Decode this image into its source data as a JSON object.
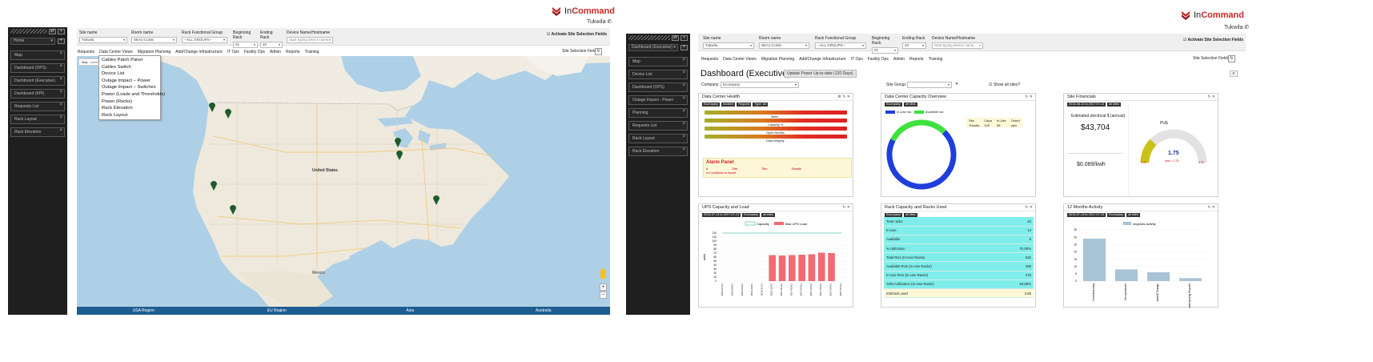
{
  "brand": {
    "name_in": "In",
    "name_command": "Command"
  },
  "screen1": {
    "site_location": "Tukwila",
    "sidebar": {
      "select": "Home",
      "items": [
        "Map",
        "Dashboard (OPS)",
        "Dashboard (Executive)",
        "Dashboard (KPI)",
        "Requests List",
        "Rack Layout",
        "Rack Elevation"
      ]
    },
    "filters": {
      "site_label": "Site name",
      "site_value": "Tukwila",
      "room_label": "Room name",
      "room_value": "SEA1-Colo5",
      "rfg_label": "Rack Functional Group",
      "rfg_value": "--ALL GROUPS--",
      "begin_label": "Beginning Rack",
      "begin_value": "01",
      "end_label": "Ending Rack",
      "end_value": "20",
      "device_label": "Device Name/Hostname",
      "device_placeholder": "Start typing device name...",
      "activate_label": "Activate Site Selection Fields"
    },
    "tabs": [
      "Requests",
      "Data Center Views",
      "Migration Planning",
      "Add/Change Infrastructure",
      "IT Ops",
      "Facility Ops",
      "Admin",
      "Reports",
      "Training"
    ],
    "site_selection_fields": "Site Selection Fields",
    "dropdown": [
      "Cables Patch Panel",
      "Cables Switch",
      "Device List",
      "Outage Impact – Power",
      "Outage Impact – Switches",
      "Power (Loads and Thresholds)",
      "Power (Racks)",
      "Rack Elevation",
      "Rack Layout"
    ],
    "map": {
      "toggle_map": "Map",
      "toggle_sat": "Satellite",
      "labels": {
        "country": "United States",
        "mexico": "Mexico"
      },
      "regions": [
        "USA Region",
        "EU Region",
        "Asia",
        "Australia"
      ]
    }
  },
  "screen2": {
    "site_location": "Tukwila",
    "sidebar": {
      "select": "Dashboard (Executive)",
      "items": [
        "Map",
        "Device List",
        "Dashboard (OPS)",
        "Outage Impact - Power",
        "Planning",
        "Requests List",
        "Rack Layout",
        "Rack Elevation"
      ]
    },
    "filters": {
      "site_label": "Site name",
      "site_value": "Tukwila",
      "room_label": "Room name",
      "room_value": "SEA1-Colo5",
      "rfg_label": "Rack Functional Group",
      "rfg_value": "--ALL GROUPS--",
      "begin_label": "Beginning Rack",
      "begin_value": "01",
      "end_label": "Ending Rack",
      "end_value": "20",
      "device_label": "Device Name/Hostname",
      "device_placeholder": "Start typing device name...",
      "activate_label": "Activate Site Selection Fields"
    },
    "tabs": [
      "Requests",
      "Data Center Views",
      "Migration Planning",
      "Add/Change Infrastructure",
      "IT Ops",
      "Facility Ops",
      "Admin",
      "Reports",
      "Training"
    ],
    "site_selection_fields": "Site Selection Fields",
    "dashboard": {
      "title": "Dashboard (Executive)",
      "update_button": "Update Power Up-to-date (120 Days)",
      "company_label": "Company:",
      "company_value": "Ecompany",
      "site_group_label": "Site Group:",
      "show_all_label": "Show all sites?"
    },
    "dc_health": {
      "title": "Data Center Health",
      "chips": [
        "Ecompany",
        "Incident",
        "Request",
        "Type: all"
      ],
      "bar_labels": [
        "Maint",
        "Capacity %",
        "Open Months",
        "Data Integrity"
      ],
      "alarm_title": "Alarm Panel",
      "alarm_cols": [
        "#",
        "Site",
        "Title",
        "Details"
      ],
      "alarm_none": "no incidents to report"
    },
    "capacity": {
      "title": "Data Center Capacity Overview",
      "chips": [
        "Ecompany",
        "all sites"
      ],
      "legend_inuse": "In-Use rac",
      "legend_avail": "Available rac",
      "headers": [
        "Site",
        "Capa",
        "In-Use",
        "Outed"
      ],
      "row": [
        "Tukwila",
        "100",
        "58",
        "uplo"
      ],
      "inuse_color": "#1e3fdc",
      "avail_color": "#3fe13f"
    },
    "financials": {
      "title": "Site Financials",
      "chips": [
        "2016-08-13 to 2017-07-13",
        "all sites"
      ],
      "subtitle": "Estimated electrical $ (annual)",
      "amount": "$43,704",
      "rate": "$0.089/kwh",
      "pue_label": "PUE",
      "pue_value": "1.75",
      "pue_min": "1.00",
      "pue_max": "4.00",
      "pue_note": "max = 1.75"
    },
    "ups": {
      "title": "UPS Capacity and Load",
      "chips": [
        "2016-07-13 to 2017-07-13",
        "Ecompany",
        "all sites"
      ],
      "legend_capacity": "Capacity",
      "legend_max": "Max UPS Load",
      "ylabel": "units"
    },
    "rack_capacity": {
      "title": "Rack Capacity and Racks Used",
      "chips": [
        "Ecompany",
        "all sites"
      ],
      "rows": [
        {
          "label": "Total racks",
          "value": "20",
          "style": "teal"
        },
        {
          "label": "In-Use",
          "value": "14",
          "style": "teal"
        },
        {
          "label": "Available",
          "value": "6",
          "style": "teal"
        },
        {
          "label": "% Utilization",
          "value": "70.00%",
          "style": "teal"
        },
        {
          "label": "Total RUs (In-Use Racks)",
          "value": "631",
          "style": "teal"
        },
        {
          "label": "Available RUs (In-Use Racks)",
          "value": "255",
          "style": "teal"
        },
        {
          "label": "In-Use RUs (In-Use Racks)",
          "value": "376",
          "style": "teal"
        },
        {
          "label": "%RU Utilization (In-Use Racks)",
          "value": "59.59%",
          "style": "teal"
        },
        {
          "label": "KW/rack used",
          "value": "3.95",
          "style": "yel"
        }
      ]
    },
    "activity": {
      "title": "12 Months Activity",
      "chips": [
        "2016-07-13 to 2017-07-13",
        "Ecompany",
        "all sites"
      ],
      "legend": "requests activity"
    }
  },
  "chart_data": [
    {
      "type": "bar",
      "title": "UPS Capacity and Load",
      "xlabel": "",
      "ylabel": "units",
      "categories": [
        "2016-07-01",
        "2016-08-01",
        "2016-09-01",
        "2016-10-01",
        "2016-11-01",
        "2016-12-01",
        "2017-01-01",
        "2017-02-01",
        "2017-03-01",
        "2017-04-01",
        "2017-05-01",
        "2017-06-01",
        "2017-07-01"
      ],
      "series": [
        {
          "name": "Capacity",
          "type": "line",
          "values": [
            120,
            120,
            120,
            120,
            120,
            120,
            120,
            120,
            120,
            120,
            120,
            120,
            120
          ]
        },
        {
          "name": "Max UPS Load",
          "type": "bar",
          "values": [
            0,
            0,
            0,
            0,
            0,
            65,
            64,
            65,
            66,
            67,
            71,
            70,
            0
          ]
        }
      ],
      "ylim": [
        0,
        120
      ],
      "yticks": [
        0,
        10,
        20,
        30,
        40,
        50,
        60,
        70,
        80,
        90,
        100,
        110,
        120
      ],
      "color_capacity": "#2fbfa7",
      "color_load": "#f26a72"
    },
    {
      "type": "bar",
      "title": "12 Months Activity",
      "categories": [
        "Commissioning",
        "Decommission",
        "Infra/IE Change",
        "Troubleshooting Request"
      ],
      "series": [
        {
          "name": "requests activity",
          "values": [
            29,
            8,
            6,
            2
          ]
        }
      ],
      "ylim": [
        0,
        35
      ],
      "yticks": [
        0,
        5,
        10,
        15,
        20,
        25,
        30,
        35
      ],
      "color": "#a9c3d6"
    },
    {
      "type": "pie",
      "title": "Data Center Capacity Overview",
      "categories": [
        "In-Use racks",
        "Available racks"
      ],
      "values": [
        70,
        30
      ]
    }
  ]
}
